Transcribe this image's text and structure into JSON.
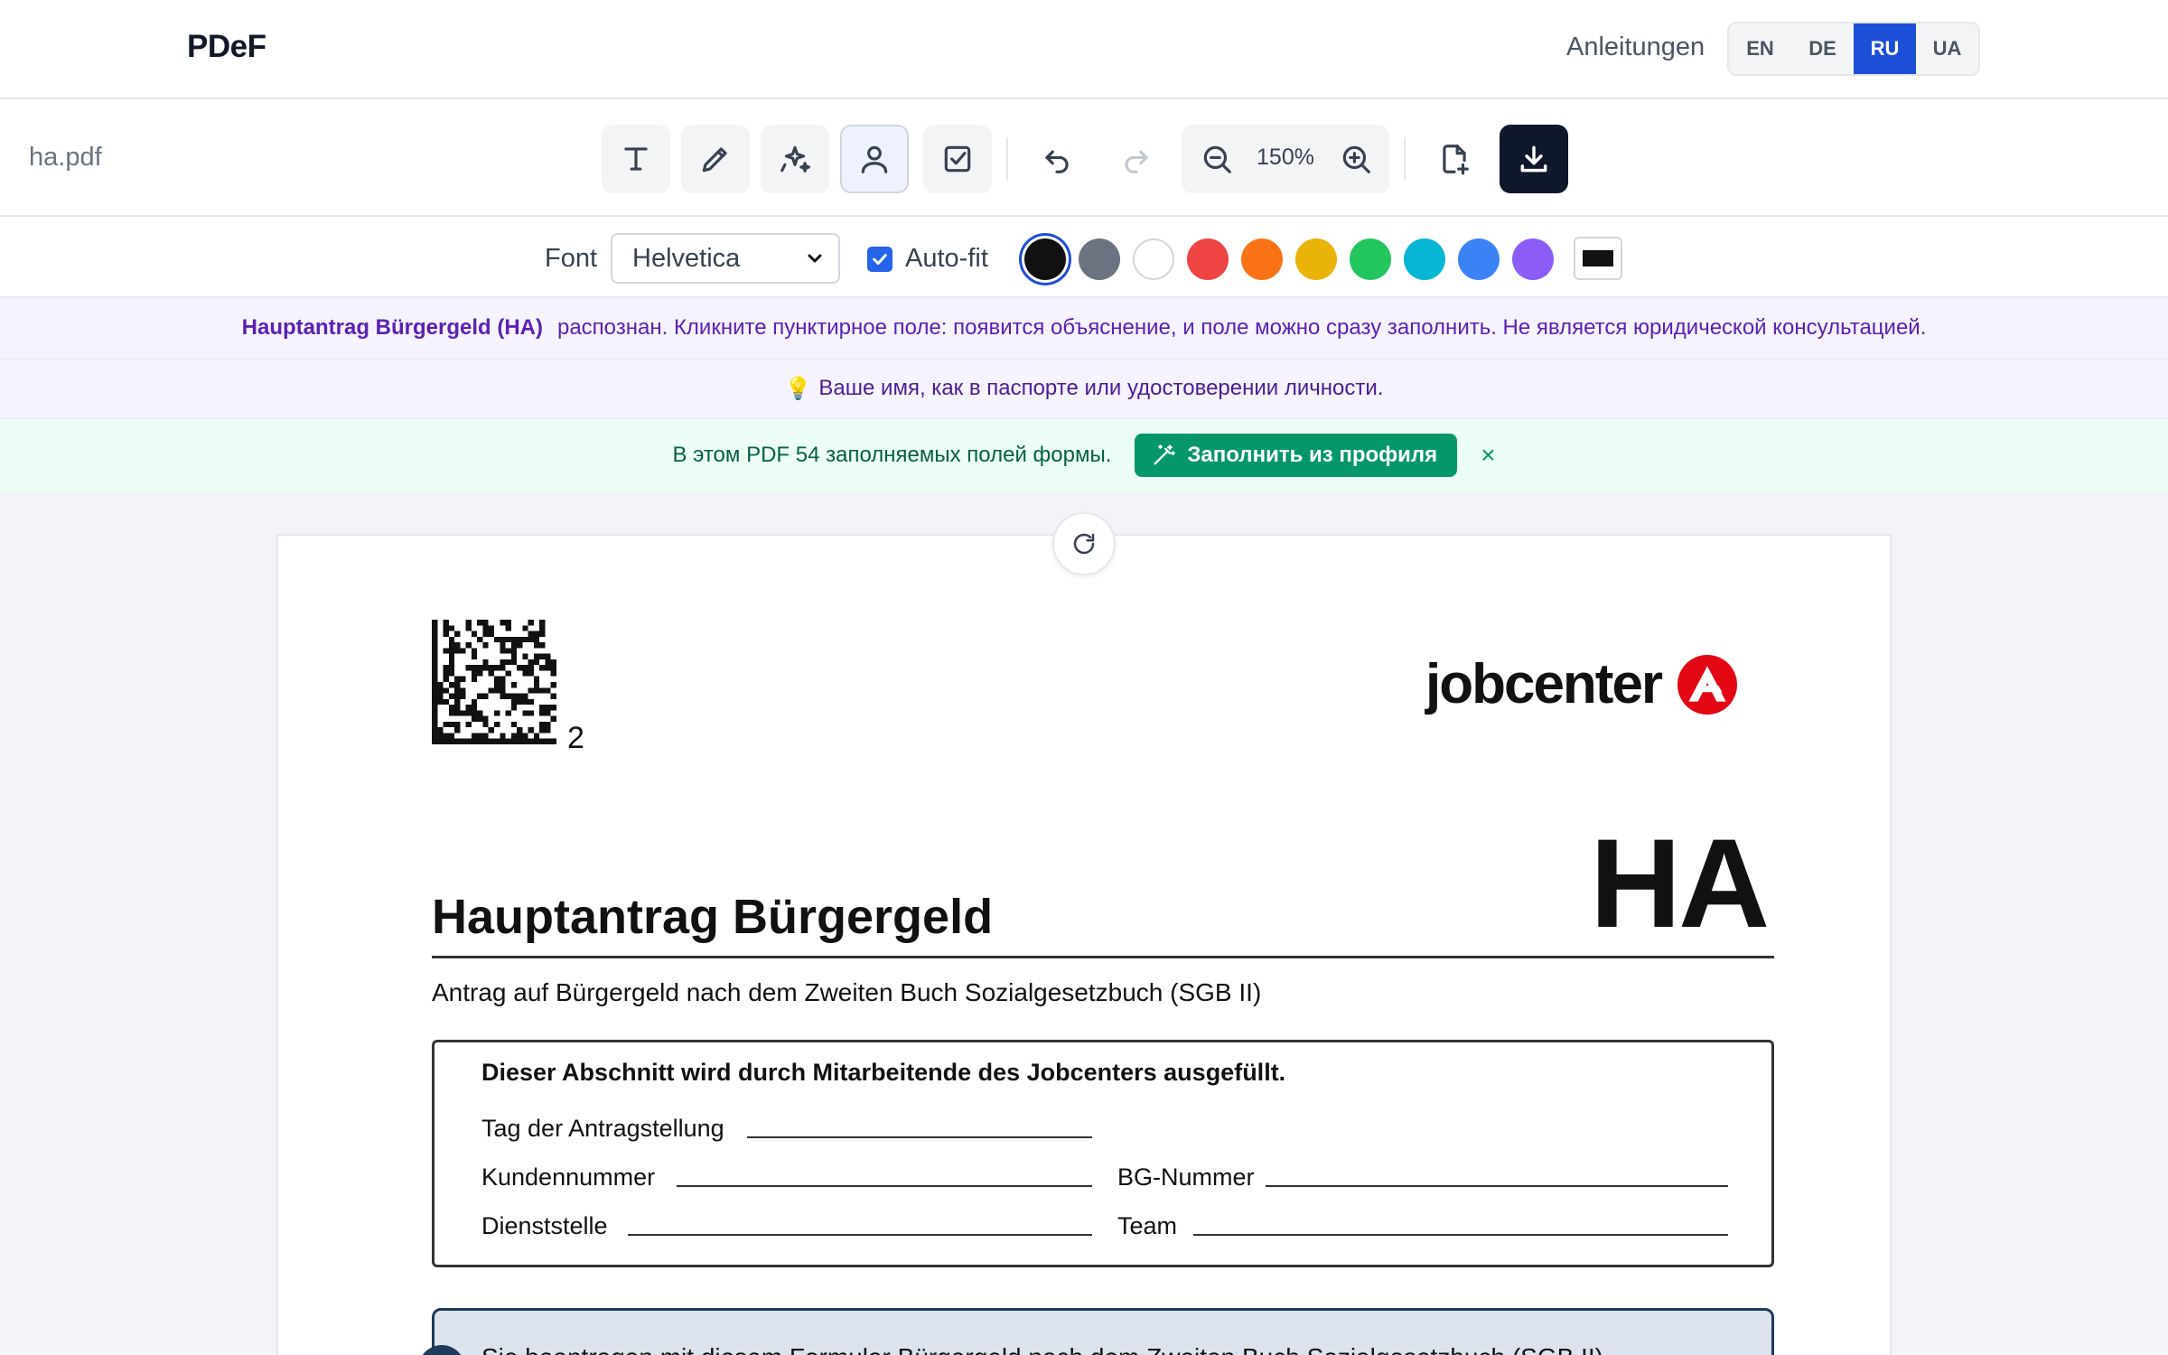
{
  "nav": {
    "brand": "PDeF",
    "guides_link": "Anleitungen",
    "languages": [
      "EN",
      "DE",
      "RU",
      "UA"
    ],
    "active_language": "RU"
  },
  "toolbar": {
    "filename": "ha.pdf",
    "zoom": "150%",
    "tools": [
      "text-icon",
      "pen-icon",
      "sparkles-icon",
      "user-icon",
      "checkbox-icon"
    ],
    "active_tool": "user-icon"
  },
  "fontbar": {
    "font_label": "Font",
    "font_value": "Helvetica",
    "autofit_label": "Auto-fit",
    "autofit_checked": true,
    "colors": [
      "#111111",
      "#6b7280",
      "#ffffff",
      "#ef4444",
      "#f97316",
      "#eab308",
      "#22c55e",
      "#06b6d4",
      "#3b82f6",
      "#8b5cf6"
    ],
    "selected_color": "#111111"
  },
  "banners": {
    "detected_form": "Hauptantrag Bürgergeld (HA)",
    "detected_text": "распознан. Кликните пунктирное поле: появится объяснение, и поле можно сразу заполнить. Не является юридической консультацией.",
    "hint_icon": "💡",
    "hint_text": "Ваше имя, как в паспорте или удостоверении личности.",
    "fields_text": "В этом PDF 54 заполняемых полей формы.",
    "fill_button": "Заполнить из профиля",
    "close_icon": "×"
  },
  "document": {
    "qr_number": "2",
    "logo_text": "jobcenter",
    "big_code": "HA",
    "title": "Hauptantrag Bürgergeld",
    "subtitle": "Antrag auf Bürgergeld nach dem Zweiten Buch Sozialgesetzbuch (SGB II)",
    "staff_box": {
      "heading": "Dieser Abschnitt wird durch Mitarbeitende des Jobcenters ausgefüllt.",
      "field_date": "Tag der Antragstellung",
      "field_customer": "Kundennummer",
      "field_bg": "BG-Nummer",
      "field_office": "Dienststelle",
      "field_team": "Team"
    },
    "info_text": "Sie beantragen mit diesem Formular Bürgergeld nach dem Zweiten Buch Sozialgesetzbuch (SGB II)."
  }
}
